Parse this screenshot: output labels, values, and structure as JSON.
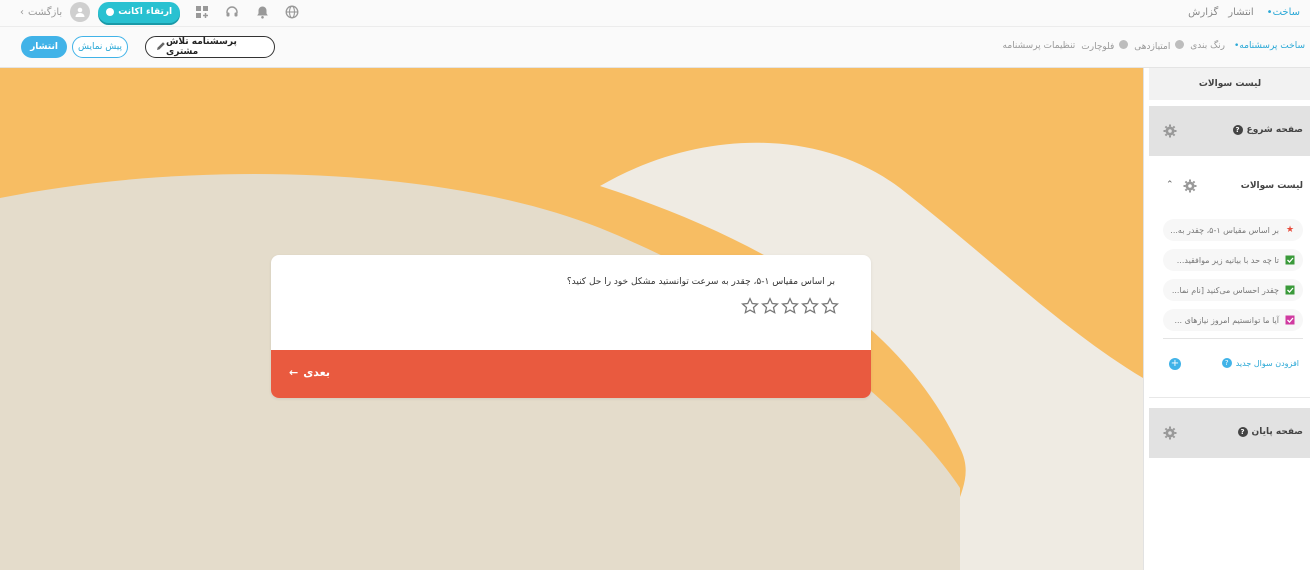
{
  "topbar": {
    "tabs": [
      {
        "label": "ساخت",
        "active": true
      },
      {
        "label": "انتشار",
        "active": false
      },
      {
        "label": "گزارش",
        "active": false
      }
    ],
    "back_label": "بازگشت",
    "upgrade_label": "ارتقاء اکانت",
    "icons": [
      "user-avatar-icon",
      "add-apps-icon",
      "headset-icon",
      "bell-icon",
      "globe-icon"
    ]
  },
  "subbar": {
    "tabs": [
      {
        "label": "ساخت پرسشنامه",
        "active": true
      },
      {
        "label": "رنگ بندی",
        "active": false
      },
      {
        "label": "امتیازدهی",
        "active": false
      },
      {
        "label": "فلوچارت",
        "active": false
      },
      {
        "label": "تنظیمات پرسشنامه",
        "active": false
      }
    ],
    "publish_label": "انتشار",
    "preview_label": "پیش نمایش",
    "survey_title": "پرسشنامه تلاش مشتری"
  },
  "card": {
    "question": "بر اساس مقیاس ۱-۵، چقدر به سرعت توانستید مشکل خود را حل کنید؟",
    "rating_max": 5,
    "rating_value": 0,
    "next_label": "بعدی"
  },
  "colors": {
    "accent": "#41b3e8",
    "upgrade": "#29c1d1",
    "next_bar": "#e95a3f",
    "canvas_orange": "#f7bd63",
    "canvas_beige": "#e4dccb",
    "canvas_light": "#efebe3"
  },
  "sidebar": {
    "header": "لیست سوالات",
    "start_page": "صفحه شروع",
    "list_title": "لیست سوالات",
    "questions": [
      {
        "label": "بر اساس مقیاس ۱-۵، چقدر به...",
        "icon": "star-icon",
        "color": "#e74c3c"
      },
      {
        "label": "تا چه حد با بیانیه زیر موافقید...",
        "icon": "checkbox-icon",
        "color": "#3a9a3a"
      },
      {
        "label": "چقدر احساس می‌کنید [نام نما...",
        "icon": "checkbox-icon",
        "color": "#3a9a3a"
      },
      {
        "label": "آیا ما توانستیم امروز نیازهای ...",
        "icon": "checkbox-icon",
        "color": "#d03aa0"
      }
    ],
    "add_question": "افزودن سوال جدید",
    "end_page": "صفحه پایان"
  }
}
